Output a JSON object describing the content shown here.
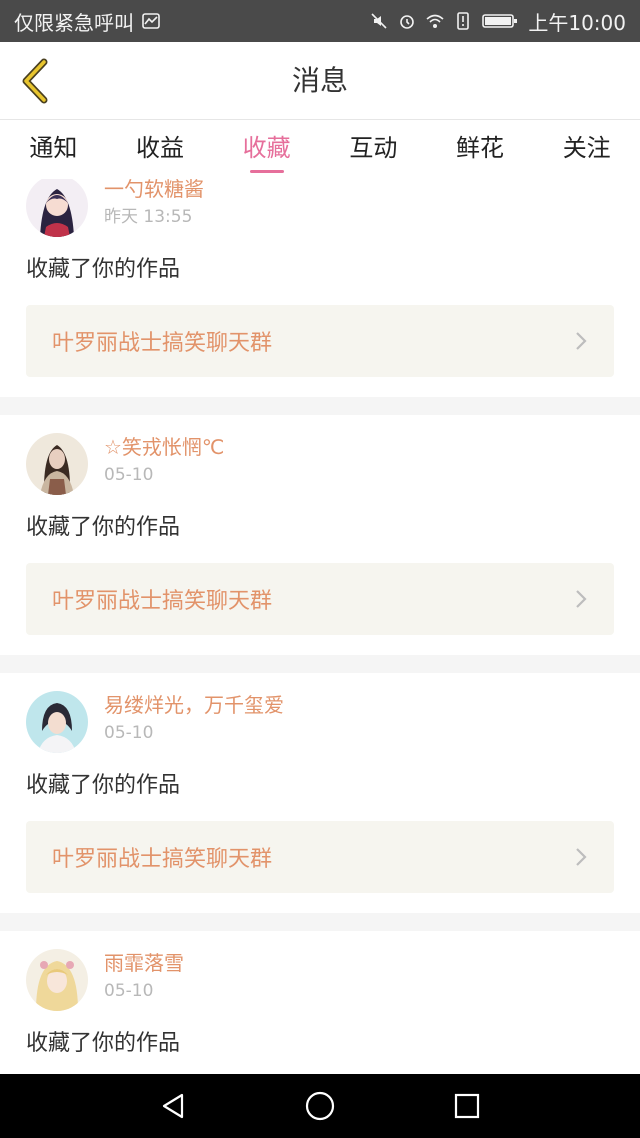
{
  "status_bar": {
    "carrier": "仅限紧急呼叫",
    "time": "上午10:00"
  },
  "header": {
    "title": "消息"
  },
  "tabs": [
    {
      "label": "通知",
      "active": false
    },
    {
      "label": "收益",
      "active": false
    },
    {
      "label": "收藏",
      "active": true
    },
    {
      "label": "互动",
      "active": false
    },
    {
      "label": "鲜花",
      "active": false
    },
    {
      "label": "关注",
      "active": false
    }
  ],
  "notifications": [
    {
      "user": "一勺软糖酱",
      "time": "昨天 13:55",
      "message": "收藏了你的作品",
      "work": "叶罗丽战士搞笑聊天群"
    },
    {
      "user": "☆笑戎怅惘℃",
      "time": "05-10",
      "message": "收藏了你的作品",
      "work": "叶罗丽战士搞笑聊天群"
    },
    {
      "user": "易缕烊光，万千玺爱",
      "time": "05-10",
      "message": "收藏了你的作品",
      "work": "叶罗丽战士搞笑聊天群"
    },
    {
      "user": "雨霏落雪",
      "time": "05-10",
      "message": "收藏了你的作品",
      "work": ""
    }
  ],
  "colors": {
    "accent": "#e66f9b",
    "name": "#e2936a",
    "work_bg": "#f6f5ef"
  }
}
